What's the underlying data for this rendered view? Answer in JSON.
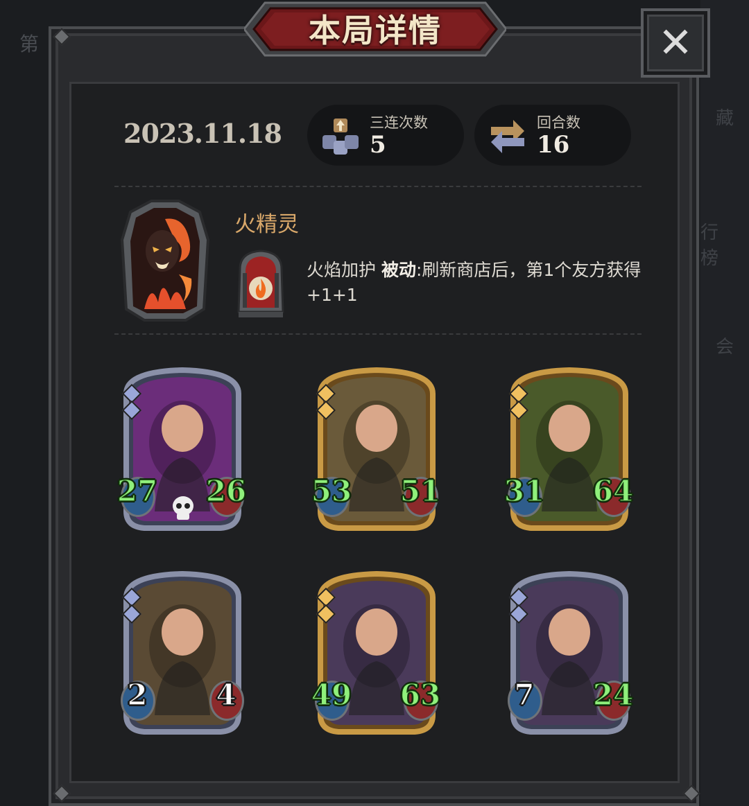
{
  "title": "本局详情",
  "close_label": "✕",
  "background_fragments": {
    "left": "第",
    "right": [
      "藏",
      "行榜",
      "会"
    ]
  },
  "date": "2023.11.18",
  "stats": {
    "triples": {
      "label": "三连次数",
      "value": "5",
      "icon": "triple-cubes-icon"
    },
    "rounds": {
      "label": "回合数",
      "value": "16",
      "icon": "refresh-arrows-icon"
    }
  },
  "hero": {
    "name": "火精灵",
    "skill_name": "火焰加护",
    "skill_type": "被动",
    "skill_desc": ":刷新商店后，第1个友方获得+1+1",
    "skill_icon": "flame-icon"
  },
  "cards": [
    {
      "attack": "27",
      "health": "26",
      "frame": "silver",
      "background": "#6b2d7a",
      "tier_pips": 2,
      "has_skull": true,
      "attack_color": "green",
      "health_color": "green"
    },
    {
      "attack": "53",
      "health": "51",
      "frame": "gold",
      "background": "#6a5a3a",
      "tier_pips": 2,
      "has_skull": false,
      "attack_color": "green",
      "health_color": "green"
    },
    {
      "attack": "31",
      "health": "64",
      "frame": "gold",
      "background": "#4a5a2a",
      "tier_pips": 2,
      "has_skull": false,
      "attack_color": "green",
      "health_color": "green"
    },
    {
      "attack": "2",
      "health": "4",
      "frame": "silver",
      "background": "#5a4a34",
      "tier_pips": 2,
      "has_skull": false,
      "attack_color": "white",
      "health_color": "white"
    },
    {
      "attack": "49",
      "health": "63",
      "frame": "gold",
      "background": "#4a3a5a",
      "tier_pips": 2,
      "has_skull": false,
      "attack_color": "green",
      "health_color": "green"
    },
    {
      "attack": "7",
      "health": "24",
      "frame": "silver",
      "background": "#4a3a5a",
      "tier_pips": 2,
      "has_skull": false,
      "attack_color": "white",
      "health_color": "green"
    }
  ]
}
